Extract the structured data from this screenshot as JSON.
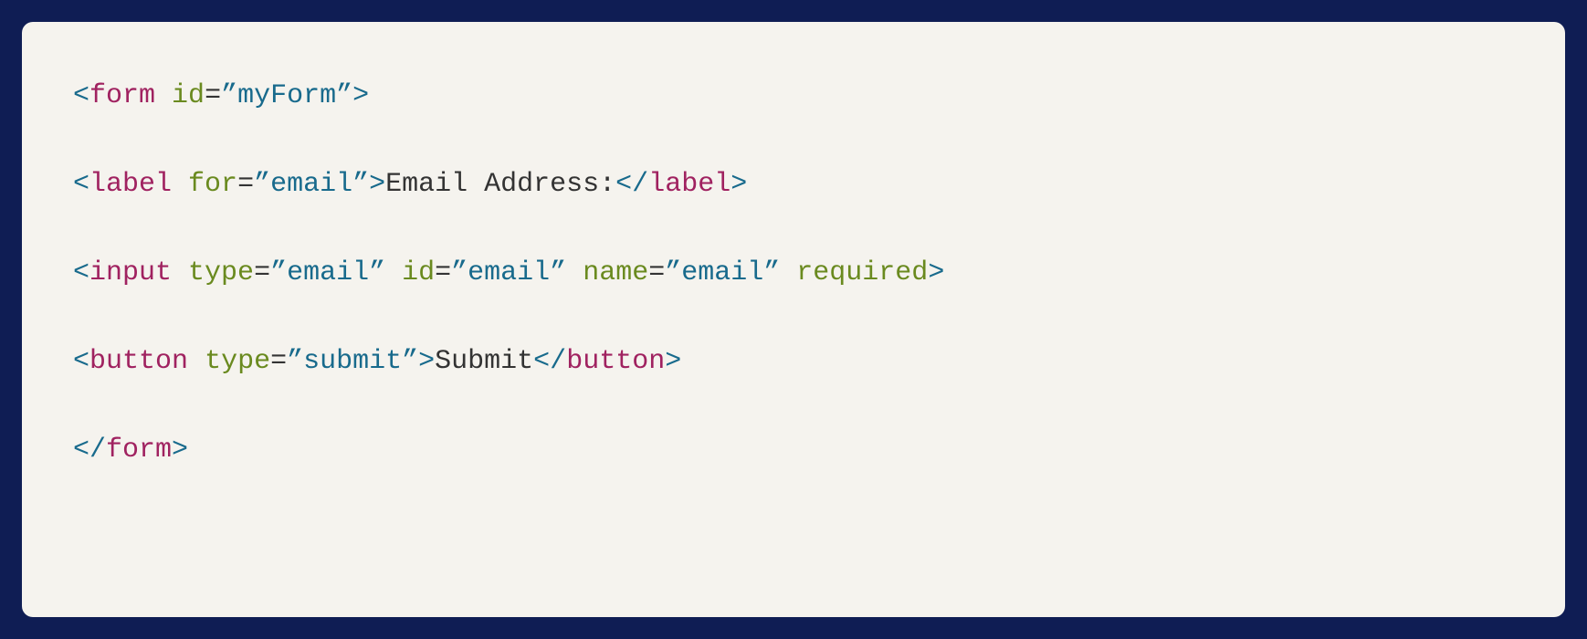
{
  "code": {
    "lines": [
      {
        "tokens": [
          {
            "cls": "bracket",
            "txt": "<"
          },
          {
            "cls": "tag",
            "txt": "form"
          },
          {
            "cls": "text",
            "txt": " "
          },
          {
            "cls": "attr-name",
            "txt": "id"
          },
          {
            "cls": "attr-eq",
            "txt": "="
          },
          {
            "cls": "attr-value",
            "txt": "”myForm”"
          },
          {
            "cls": "bracket",
            "txt": ">"
          }
        ]
      },
      {
        "tokens": [
          {
            "cls": "bracket",
            "txt": "<"
          },
          {
            "cls": "tag",
            "txt": "label"
          },
          {
            "cls": "text",
            "txt": " "
          },
          {
            "cls": "attr-name",
            "txt": "for"
          },
          {
            "cls": "attr-eq",
            "txt": "="
          },
          {
            "cls": "attr-value",
            "txt": "”email”"
          },
          {
            "cls": "bracket",
            "txt": ">"
          },
          {
            "cls": "text",
            "txt": "Email Address:"
          },
          {
            "cls": "bracket",
            "txt": "</"
          },
          {
            "cls": "tag",
            "txt": "label"
          },
          {
            "cls": "bracket",
            "txt": ">"
          }
        ]
      },
      {
        "tokens": [
          {
            "cls": "bracket",
            "txt": "<"
          },
          {
            "cls": "tag",
            "txt": "input"
          },
          {
            "cls": "text",
            "txt": " "
          },
          {
            "cls": "attr-name",
            "txt": "type"
          },
          {
            "cls": "attr-eq",
            "txt": "="
          },
          {
            "cls": "attr-value",
            "txt": "”email”"
          },
          {
            "cls": "text",
            "txt": " "
          },
          {
            "cls": "attr-name",
            "txt": "id"
          },
          {
            "cls": "attr-eq",
            "txt": "="
          },
          {
            "cls": "attr-value",
            "txt": "”email”"
          },
          {
            "cls": "text",
            "txt": " "
          },
          {
            "cls": "attr-name",
            "txt": "name"
          },
          {
            "cls": "attr-eq",
            "txt": "="
          },
          {
            "cls": "attr-value",
            "txt": "”email”"
          },
          {
            "cls": "text",
            "txt": " "
          },
          {
            "cls": "attr-name",
            "txt": "required"
          },
          {
            "cls": "bracket",
            "txt": ">"
          }
        ]
      },
      {
        "tokens": [
          {
            "cls": "bracket",
            "txt": "<"
          },
          {
            "cls": "tag",
            "txt": "button"
          },
          {
            "cls": "text",
            "txt": " "
          },
          {
            "cls": "attr-name",
            "txt": "type"
          },
          {
            "cls": "attr-eq",
            "txt": "="
          },
          {
            "cls": "attr-value",
            "txt": "”submit”"
          },
          {
            "cls": "bracket",
            "txt": ">"
          },
          {
            "cls": "text",
            "txt": "Submit"
          },
          {
            "cls": "bracket",
            "txt": "</"
          },
          {
            "cls": "tag",
            "txt": "button"
          },
          {
            "cls": "bracket",
            "txt": ">"
          }
        ]
      },
      {
        "tokens": [
          {
            "cls": "bracket",
            "txt": "</"
          },
          {
            "cls": "tag",
            "txt": "form"
          },
          {
            "cls": "bracket",
            "txt": ">"
          }
        ]
      }
    ]
  }
}
